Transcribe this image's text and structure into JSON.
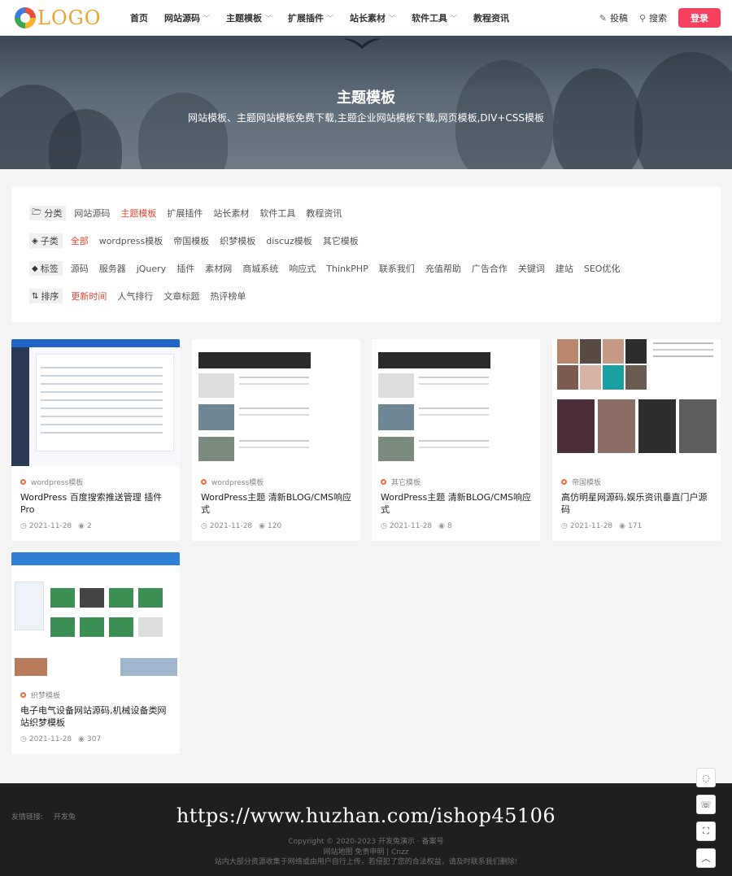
{
  "header": {
    "logo_text": "LOGO",
    "nav": [
      {
        "label": "首页",
        "dropdown": false
      },
      {
        "label": "网站源码",
        "dropdown": true
      },
      {
        "label": "主题模板",
        "dropdown": true
      },
      {
        "label": "扩展插件",
        "dropdown": true
      },
      {
        "label": "站长素材",
        "dropdown": true
      },
      {
        "label": "软件工具",
        "dropdown": true
      },
      {
        "label": "教程资讯",
        "dropdown": false
      }
    ],
    "submit_label": "投稿",
    "search_label": "搜索",
    "login_label": "登录",
    "accent_color": "#f5415f"
  },
  "banner": {
    "title": "主题模板",
    "subtitle": "网站模板、主题网站模板免费下载,主题企业网站模板下载,网页模板,DIV+CSS模板"
  },
  "filters": {
    "category": {
      "label": "分类",
      "options": [
        "网站源码",
        "主题模板",
        "扩展插件",
        "站长素材",
        "软件工具",
        "教程资讯"
      ],
      "active": 1
    },
    "subcategory": {
      "label": "子类",
      "options": [
        "全部",
        "wordpress模板",
        "帝国模板",
        "织梦模板",
        "discuz模板",
        "其它模板"
      ],
      "active": 0
    },
    "tags": {
      "label": "标签",
      "options": [
        "源码",
        "服务器",
        "jQuery",
        "插件",
        "素材网",
        "商城系统",
        "响应式",
        "ThinkPHP",
        "联系我们",
        "充值帮助",
        "广告合作",
        "关键词",
        "建站",
        "SEO优化"
      ],
      "active": -1
    },
    "sort": {
      "label": "排序",
      "options": [
        "更新时间",
        "人气排行",
        "文章标题",
        "热评榜单"
      ],
      "active": 0
    },
    "active_color": "#e5462f"
  },
  "cards": [
    {
      "category": "wordpress模板",
      "title": "WordPress 百度搜索推送管理 插件 Pro",
      "date": "2021-11-28",
      "views": "2"
    },
    {
      "category": "wordpress模板",
      "title": "WordPress主题 清新BLOG/CMS响应式",
      "date": "2021-11-28",
      "views": "120"
    },
    {
      "category": "其它模板",
      "title": "WordPress主题 清新BLOG/CMS响应式",
      "date": "2021-11-28",
      "views": "8"
    },
    {
      "category": "帝国模板",
      "title": "高仿明星网源码,娱乐资讯垂直门户源码",
      "date": "2021-11-28",
      "views": "171"
    },
    {
      "category": "织梦模板",
      "title": "电子电气设备网站源码,机械设备类网站织梦模板",
      "date": "2021-11-28",
      "views": "307"
    }
  ],
  "footer": {
    "links_label": "友情链接:",
    "links": [
      "开发兔"
    ],
    "watermark_url": "https://www.huzhan.com/ishop45106",
    "copyright": "Copyright © 2020-2023 开发兔演示 · 备案号",
    "sitemap": "网站地图 免责申明 | Cnzz",
    "notice": "站内大部分资源收集于网络或由用户自行上传，若侵犯了您的合法权益，请及时联系我们删除!"
  }
}
